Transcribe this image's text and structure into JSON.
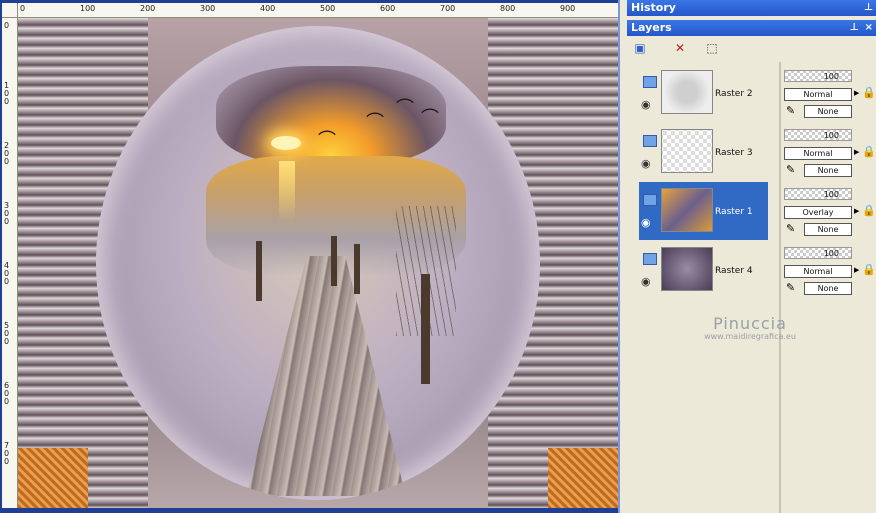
{
  "ruler": {
    "top_ticks": [
      "0",
      "100",
      "200",
      "300",
      "400",
      "500",
      "600",
      "700",
      "800",
      "900"
    ],
    "left_ticks": [
      "0",
      "1\n0\n0",
      "2\n0\n0",
      "3\n0\n0",
      "4\n0\n0",
      "5\n0\n0",
      "6\n0\n0",
      "7\n0\n0"
    ]
  },
  "history_panel": {
    "title": "History"
  },
  "layers_panel": {
    "title": "Layers",
    "layers": [
      {
        "name": "Raster 2",
        "opacity": "100",
        "blend": "Normal",
        "mask": "None",
        "selected": false
      },
      {
        "name": "Raster 3",
        "opacity": "100",
        "blend": "Normal",
        "mask": "None",
        "selected": false
      },
      {
        "name": "Raster 1",
        "opacity": "100",
        "blend": "Overlay",
        "mask": "None",
        "selected": true
      },
      {
        "name": "Raster 4",
        "opacity": "100",
        "blend": "Normal",
        "mask": "None",
        "selected": false
      }
    ]
  },
  "watermark": {
    "name": "Pinuccia",
    "url": "www.maidiregrafica.eu"
  },
  "icons": {
    "pin": "pin-icon",
    "close": "close-icon",
    "new_layer": "new-layer-icon",
    "delete_layer": "delete-layer-icon",
    "select": "select-icon",
    "eye": "eye-icon",
    "lock": "lock-icon",
    "brush": "brush-icon",
    "raster": "raster-layer-icon"
  },
  "colors": {
    "titlebar": "#2456c9",
    "selected": "#316ac5",
    "panel": "#ece9d8"
  }
}
